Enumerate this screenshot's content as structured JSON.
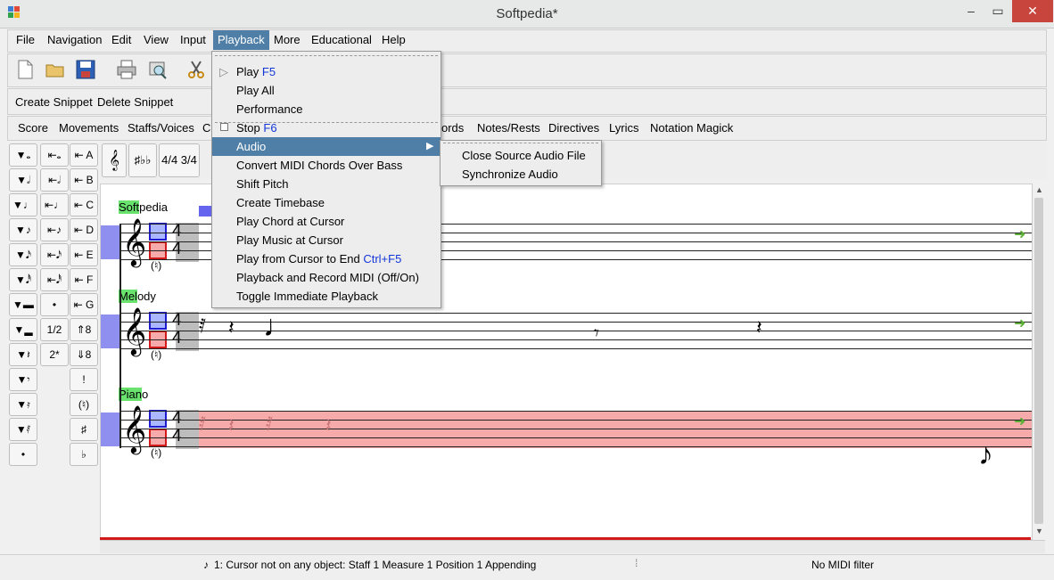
{
  "window": {
    "title": "Softpedia*"
  },
  "menubar": {
    "items": [
      "File",
      "Navigation",
      "Edit",
      "View",
      "Input",
      "Playback",
      "More",
      "Educational",
      "Help"
    ]
  },
  "snippets": {
    "create": "Create Snippet",
    "delete": "Delete Snippet"
  },
  "tabs": [
    "Score",
    "Movements",
    "Staffs/Voices",
    "C",
    "ords",
    "Notes/Rests",
    "Directives",
    "Lyrics",
    "Notation Magick"
  ],
  "palette": {
    "col1": [
      "▼𝅝",
      "▼𝅗𝅥",
      "▼♩",
      "▼♪",
      "▼𝅘𝅥𝅯",
      "▼𝅘𝅥𝅰",
      "▼▬",
      "▼▂",
      "▼𝄽",
      "▼𝄾",
      "▼𝄿",
      "▼𝅀",
      "•"
    ],
    "col2": [
      "⇤𝅝",
      "⇤𝅗𝅥",
      "⇤♩",
      "⇤♪",
      "⇤𝅘𝅥𝅯",
      "⇤𝅘𝅥𝅰",
      "•",
      "1/2",
      "2*",
      "!",
      "(♮)",
      "♯",
      "♭"
    ],
    "col3": [
      "⇤ A",
      "⇤ B",
      "⇤ C",
      "⇤ D",
      "⇤ E",
      "⇤ F",
      "⇤ G",
      "⇑8",
      "⇓8"
    ]
  },
  "palette2": {
    "clef": "𝄞",
    "keysig": "♯♭♭",
    "timesig": "4/4 3/4"
  },
  "staves": [
    {
      "name_hl": "Soft",
      "name_rest": "pedia"
    },
    {
      "name_hl": "Mel",
      "name_rest": "ody"
    },
    {
      "name_hl": "Pian",
      "name_rest": "o"
    }
  ],
  "score": {
    "time_top": "4",
    "time_bottom": "4",
    "natural": "(♮)"
  },
  "playback_menu": {
    "items": [
      {
        "label": "Play",
        "key": "F5"
      },
      {
        "label": "Play All",
        "key": ""
      },
      {
        "label": "Performance",
        "key": ""
      },
      {
        "label": "Stop",
        "key": "F6"
      },
      {
        "label": "Audio",
        "key": ""
      },
      {
        "label": "Convert MIDI Chords Over Bass",
        "key": ""
      },
      {
        "label": "Shift Pitch",
        "key": ""
      },
      {
        "label": "Create Timebase",
        "key": ""
      },
      {
        "label": "Play Chord at Cursor",
        "key": ""
      },
      {
        "label": "Play Music at Cursor",
        "key": ""
      },
      {
        "label": "Play from Cursor to End",
        "key": "Ctrl+F5"
      },
      {
        "label": "Playback and Record MIDI (Off/On)",
        "key": ""
      },
      {
        "label": "Toggle Immediate Playback",
        "key": ""
      }
    ]
  },
  "audio_submenu": {
    "items": [
      "Close Source Audio File",
      "Synchronize Audio"
    ]
  },
  "statusbar": {
    "cursor": "1: Cursor not on any object:  Staff 1 Measure 1 Position 1 Appending",
    "midi": "No MIDI filter"
  },
  "colors": {
    "accent": "#4f7fa7",
    "shortcut": "#1436d8",
    "highlight": "#69e36d",
    "staff_selected": "#f6aaaa",
    "close": "#c7453d"
  }
}
